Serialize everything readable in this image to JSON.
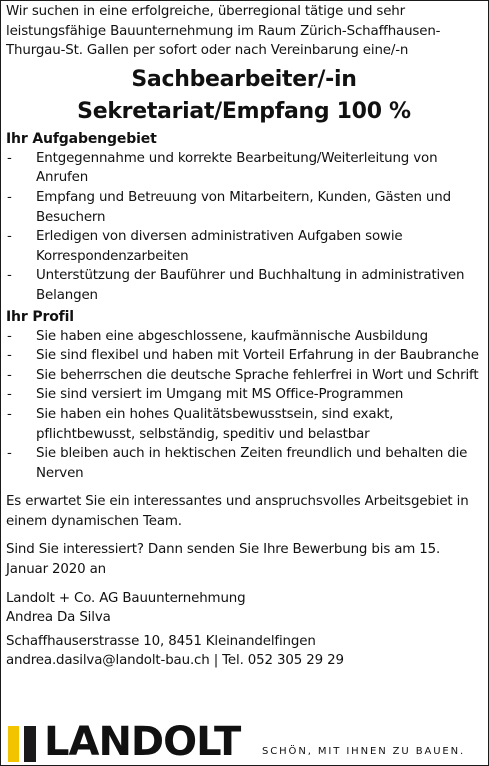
{
  "intro": "Wir suchen in eine erfolgreiche, überregional tätige und sehr leistungsfähige Bauunternehmung im Raum Zürich-Schaffhausen-Thurgau-St. Gallen per sofort oder nach Vereinbarung eine/-n",
  "title_line1": "Sachbearbeiter/-in",
  "title_line2": "Sekretariat/Empfang 100 %",
  "tasks": {
    "heading": "Ihr Aufgabengebiet",
    "items": [
      "Entgegennahme und korrekte Bearbeitung/Weiterleitung von Anrufen",
      "Empfang und Betreuung von Mitarbeitern, Kunden, Gästen und Besuchern",
      "Erledigen von diversen administrativen Aufgaben sowie Korrespondenzarbeiten",
      "Unterstützung der Bauführer und Buchhaltung in administrativen Belangen"
    ]
  },
  "profile": {
    "heading": "Ihr Profil",
    "items": [
      "Sie haben eine abgeschlossene, kaufmännische Ausbildung",
      "Sie sind flexibel und haben mit Vorteil Erfahrung in der Baubranche",
      "Sie beherrschen die deutsche Sprache fehlerfrei in Wort und Schrift",
      "Sie sind versiert im Umgang mit MS Office-Programmen",
      "Sie haben ein hohes Qualitätsbewusstsein, sind exakt, pflichtbewusst, selbständig, speditiv und belastbar",
      "Sie bleiben auch in hektischen Zeiten freundlich und behalten die Nerven"
    ]
  },
  "offer": "Es erwartet Sie ein interessantes und anspruchsvolles Arbeitsgebiet in einem dynamischen Team.",
  "apply": "Sind Sie interessiert? Dann senden Sie Ihre Bewerbung bis am 15. Januar 2020 an",
  "contact": {
    "company": "Landolt + Co. AG Bauunternehmung",
    "person": "Andrea Da Silva",
    "address": "Schaffhauserstrasse 10, 8451 Kleinandelfingen",
    "email_phone": "andrea.dasilva@landolt-bau.ch | Tel. 052 305 29 29"
  },
  "brand": {
    "wordmark": "LANDOLT",
    "slogan": "SCHÖN, MIT IHNEN ZU BAUEN.",
    "logo_icon": "landolt-bars-logo",
    "colors": {
      "yellow": "#f2c400",
      "black": "#1a1a1a"
    }
  }
}
